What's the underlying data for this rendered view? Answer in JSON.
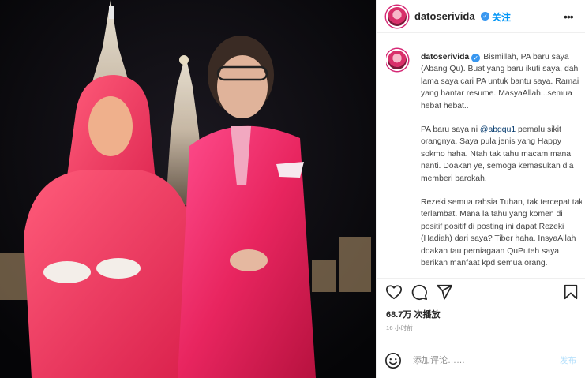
{
  "post": {
    "username": "datoserivida",
    "follow_label": "关注",
    "more_label": "•••",
    "verified_mark": "✓"
  },
  "caption": {
    "username": "datoserivida",
    "paragraphs": [
      "Bismillah, PA baru saya (Abang Qu). Buat yang baru ikuti saya, dah lama saya cari PA untuk bantu saya. Ramai yang hantar resume. MasyaAllah...semua hebat hebat..",
      "PA baru saya ni",
      "Rezeki semua rahsia Tuhan, tak tercepat tak terlambat. Mana la tahu yang komen di positif positif di posting ini dapat Rezeki (Hadiah) dari saya? Tiber haha. InsyaAllah doakan tau perniagaan QuPuteh saya berikan manfaat kpd semua orang."
    ],
    "mention": "@abgqu1",
    "p2_rest": "pemalu sikit orangnya. Saya pula jenis yang Happy sokmo haha. Ntah tak tahu macam mana nanti. Doakan ye, semoga kemasukan dia memberi barokah."
  },
  "stats": {
    "views": "68.7万 次播放",
    "time": "16 小时前"
  },
  "comment": {
    "placeholder": "添加评论……",
    "post_label": "发布"
  },
  "icons": [
    "heart-icon",
    "comment-icon",
    "share-icon",
    "bookmark-icon",
    "emoji-icon",
    "more-icon"
  ],
  "colors": {
    "accent": "#0095f6",
    "suit": "#e8255f",
    "dress": "#e8335d"
  }
}
